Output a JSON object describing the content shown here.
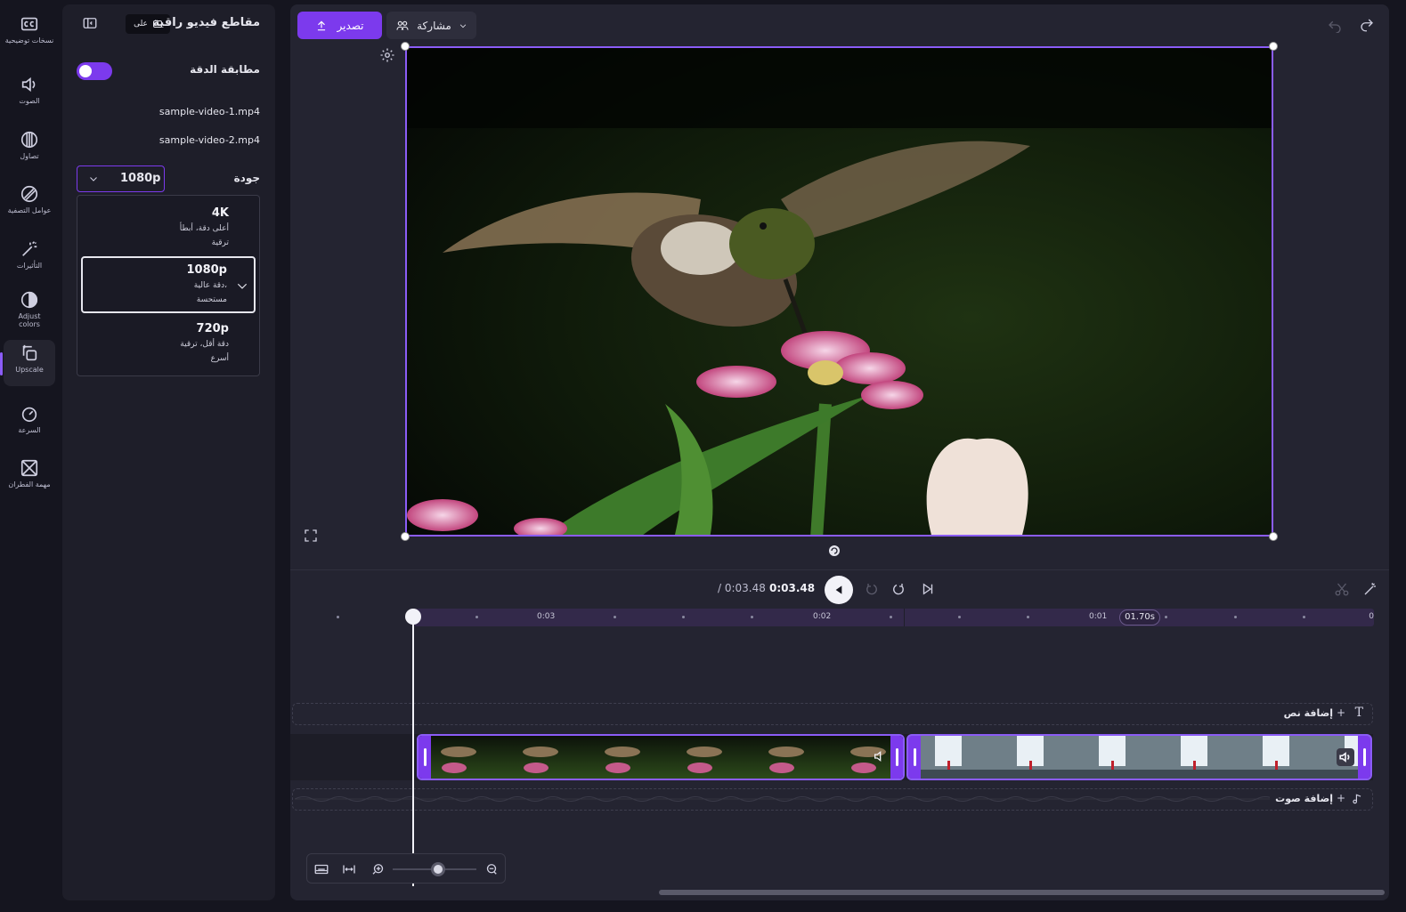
{
  "rail": {
    "items": [
      {
        "label": "نسخات توضيحية",
        "icon": "captions-icon"
      },
      {
        "label": "الصوت",
        "icon": "audio-icon"
      },
      {
        "label": "تصاول",
        "icon": "fade-icon"
      },
      {
        "label": "عوامل التصفية",
        "icon": "filters-icon"
      },
      {
        "label": "التأثيرات",
        "icon": "effects-icon"
      },
      {
        "label": "Adjust colors",
        "icon": "adjust-colors-icon"
      },
      {
        "label": "Upscale",
        "icon": "upscale-icon"
      },
      {
        "label": "السرعة",
        "icon": "speed-icon"
      },
      {
        "label": "مهمة الفطران",
        "icon": "transition-icon"
      }
    ],
    "active_index": 6
  },
  "panel": {
    "title": "مقاطع فيديو راقية",
    "badge_label": "على",
    "match_resolution_label": "مطابقة الدقة",
    "match_resolution_on": true,
    "files": [
      "sample-video-1.mp4",
      "sample-video-2.mp4"
    ],
    "quality_label": "جودة",
    "quality_value": "1080p",
    "options": [
      {
        "title": "4K",
        "desc1": "أعلى دقة، أبطأ",
        "desc2": "ترقية",
        "selected": false
      },
      {
        "title": "1080p",
        "desc1": "دقة عالية،",
        "desc2": "مستحسة",
        "selected": true
      },
      {
        "title": "720p",
        "desc1": "دقة أقل، ترقية",
        "desc2": "أسرع",
        "selected": false
      }
    ]
  },
  "toolbar": {
    "export_label": "تصدير",
    "share_label": "مشاركة"
  },
  "player": {
    "current_time": "0:03.48",
    "total_time": "/ 0:03.48"
  },
  "timeline": {
    "ruler_labels": [
      "0",
      "0:01",
      "0:02",
      "0:03"
    ],
    "cursor_time": "01.70s",
    "add_text_label": "إضافة نص",
    "add_audio_label": "إضافة صوت"
  },
  "colors": {
    "accent": "#7c3aed",
    "background": "#15151f",
    "panel": "#1e1e29"
  }
}
